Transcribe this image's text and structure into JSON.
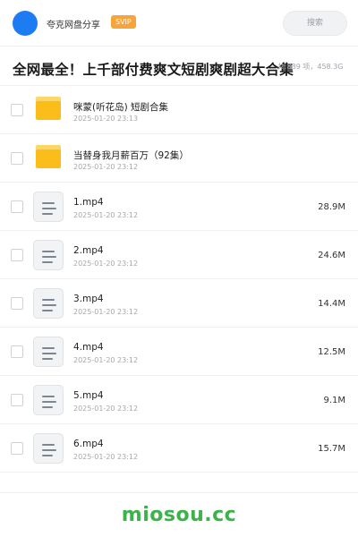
{
  "header": {
    "brand": "夸克网盘分享",
    "badge": "SVIP",
    "search_placeholder": "搜索"
  },
  "share": {
    "title": "全网最全！上千部付费爽文短剧爽剧超大合集",
    "meta": "共 889 项，458.3G"
  },
  "items": [
    {
      "type": "folder",
      "name": "咪蒙(听花岛) 短剧合集",
      "date": "2025-01-20 23:13",
      "size": ""
    },
    {
      "type": "folder",
      "name": "当替身我月薪百万（92集）",
      "date": "2025-01-20 23:12",
      "size": ""
    },
    {
      "type": "file",
      "name": "1.mp4",
      "date": "2025-01-20 23:12",
      "size": "28.9M"
    },
    {
      "type": "file",
      "name": "2.mp4",
      "date": "2025-01-20 23:12",
      "size": "24.6M"
    },
    {
      "type": "file",
      "name": "3.mp4",
      "date": "2025-01-20 23:12",
      "size": "14.4M"
    },
    {
      "type": "file",
      "name": "4.mp4",
      "date": "2025-01-20 23:12",
      "size": "12.5M"
    },
    {
      "type": "file",
      "name": "5.mp4",
      "date": "2025-01-20 23:12",
      "size": "9.1M"
    },
    {
      "type": "file",
      "name": "6.mp4",
      "date": "2025-01-20 23:12",
      "size": "15.7M"
    }
  ],
  "icons": {
    "folder": "folder-icon",
    "file": "video-file-icon"
  },
  "colors": {
    "accent": "#1e7cf2",
    "svip": "#f7a53b",
    "folder": "#fbbd1a",
    "watermark": "#3cb34a"
  },
  "footer": {
    "watermark": "miosou.cc"
  }
}
